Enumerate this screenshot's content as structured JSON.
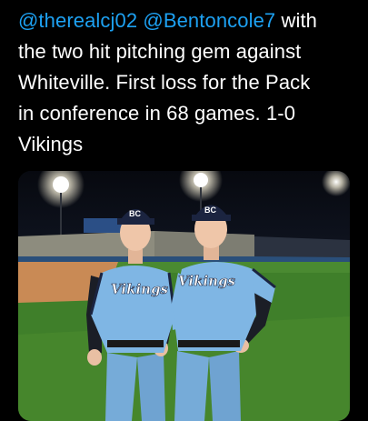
{
  "tweet": {
    "mention_1": "@therealcj02",
    "mention_2": "@Bentoncole7",
    "line_1_tail": "with",
    "line_2": "the two hit pitching gem against",
    "line_3": "Whiteville.  First loss for the Pack",
    "line_4": "in conference in 68 games.  1-0",
    "line_5": "Vikings"
  },
  "photo": {
    "jersey_text": "Vikings",
    "cap_logo_text": "BC",
    "colors": {
      "mention_blue": "#1da1f2",
      "jersey_blue": "#7fb6e4",
      "navy": "#1b2440",
      "grass": "#3f7f2a",
      "dirt": "#c98a55"
    }
  }
}
